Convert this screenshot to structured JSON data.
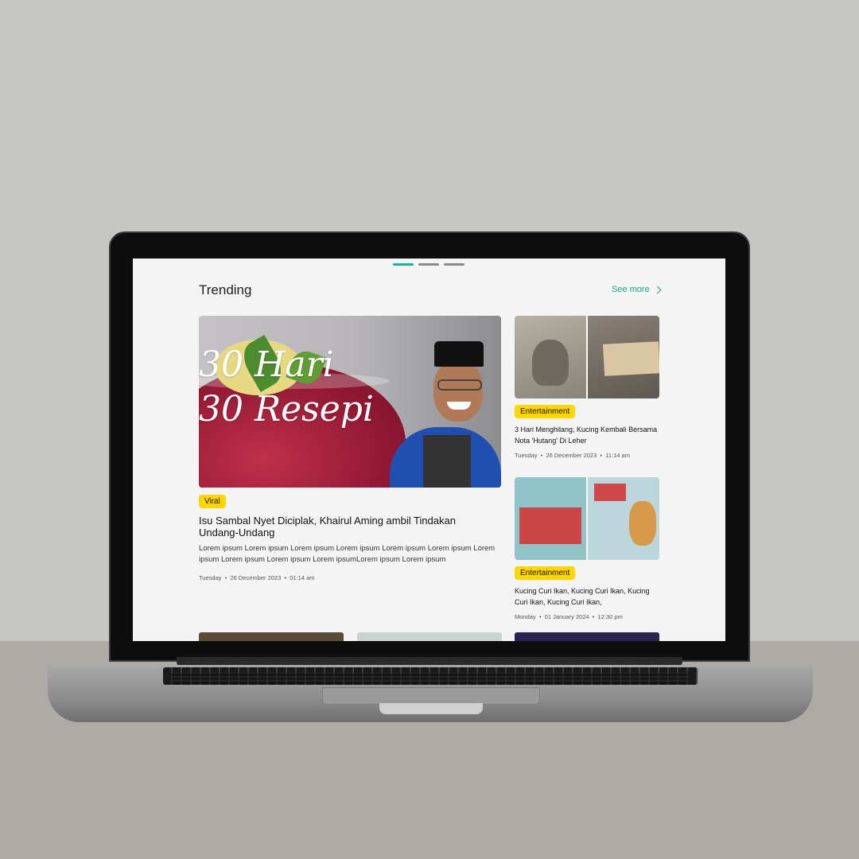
{
  "pagination": {
    "count": 3,
    "active": 0
  },
  "section": {
    "title": "Trending",
    "see_more": "See more"
  },
  "feature": {
    "image_text_line1": "30 Hari",
    "image_text_line2": "30 Resepi",
    "tag": "Viral",
    "title": "Isu Sambal Nyet Diciplak, Khairul Aming ambil Tindakan Undang-Undang",
    "description": "Lorem ipsum Lorem ipsum Lorem ipsum Lorem ipsum Lorem ipsum Lorem ipsum Lorem ipsum Lorem ipsum Lorem ipsum Lorem ipsumLorem ipsum Lorem ipsum",
    "day": "Tuesday",
    "date": "26 December 2023",
    "time": "01:14 am"
  },
  "side_articles": [
    {
      "tag": "Entertainment",
      "title": "3 Hari Menghilang, Kucing Kembali Bersama Nota 'Hutang' Di Leher",
      "day": "Tuesday",
      "date": "26 December 2023",
      "time": "11:14 am"
    },
    {
      "tag": "Entertainment",
      "title": "Kucing Curi Ikan, Kucing Curi Ikan, Kucing Curi Ikan, Kucing Curi Ikan,",
      "day": "Monday",
      "date": "01 January 2024",
      "time": "12:30 pm"
    }
  ],
  "colors": {
    "accent": "#1ab394",
    "tag": "#ffd600",
    "screen_bg": "#f4f4f4"
  },
  "icons": {
    "see_more": "chevron-right-icon"
  }
}
